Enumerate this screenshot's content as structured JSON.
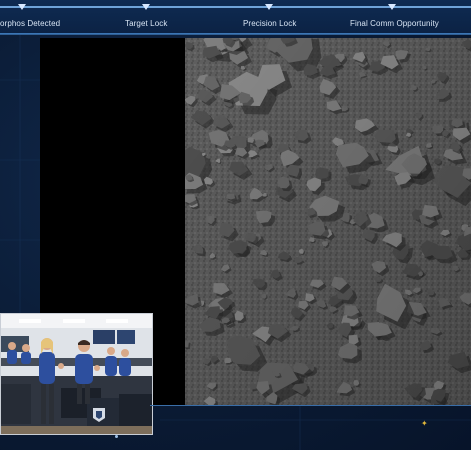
{
  "timeline": {
    "milestones": [
      {
        "label": "orphos Detected"
      },
      {
        "label": "Target Lock"
      },
      {
        "label": "Precision Lock"
      },
      {
        "label": "Final Comm Opportunity"
      }
    ]
  },
  "camera": {
    "feed": "asteroid-surface-closeup"
  },
  "team_video": {
    "content": "mission-control-team-celebrating"
  },
  "icons": {
    "bottom_mark": "sparkle-icon"
  },
  "colors": {
    "background": "#0a1a33",
    "timeline_accent": "#6fa3d8",
    "panel_border": "#3a6ea8",
    "mark": "#e2b83a"
  }
}
